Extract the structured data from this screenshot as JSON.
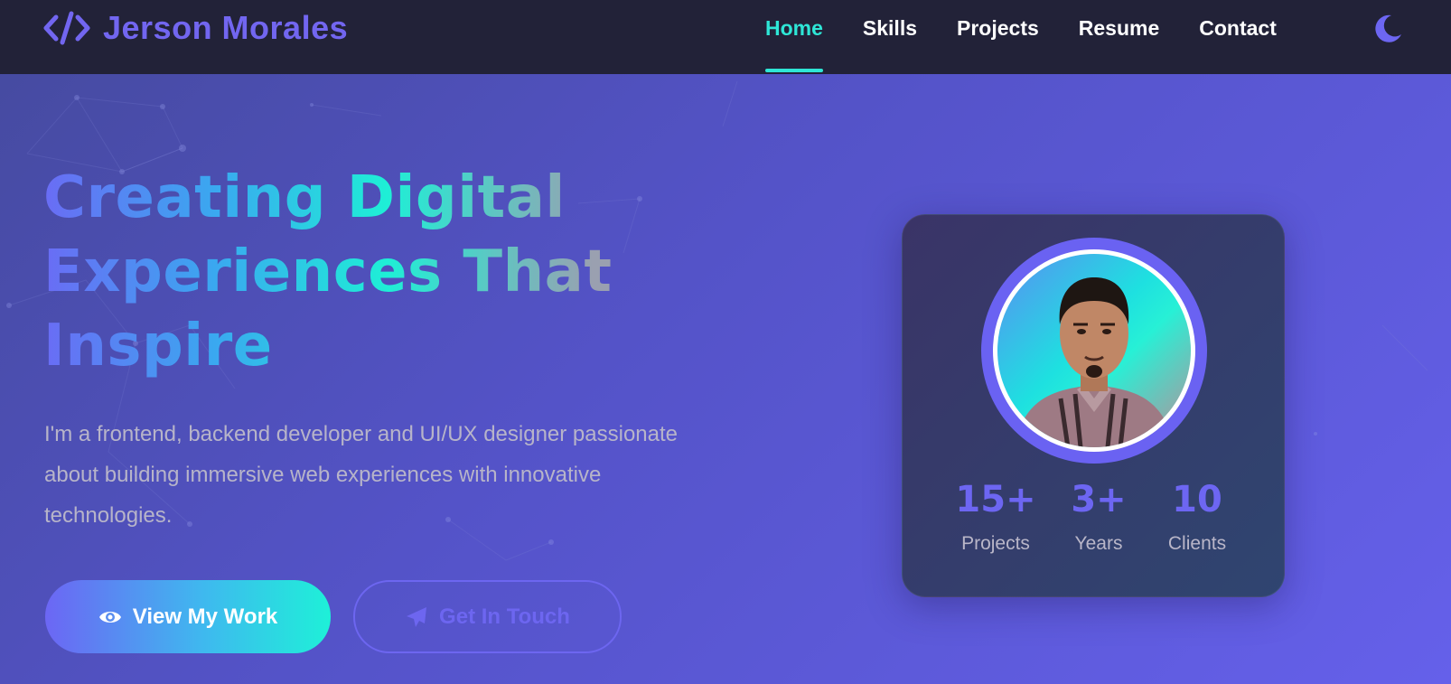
{
  "brand": {
    "name": "Jerson Morales",
    "logo_icon": "code-icon"
  },
  "nav": {
    "items": [
      {
        "label": "Home",
        "active": true
      },
      {
        "label": "Skills",
        "active": false
      },
      {
        "label": "Projects",
        "active": false
      },
      {
        "label": "Resume",
        "active": false
      },
      {
        "label": "Contact",
        "active": false
      }
    ],
    "theme_toggle_icon": "moon-icon"
  },
  "hero": {
    "title_lines": [
      "Creating Digital",
      "Experiences That",
      "Inspire"
    ],
    "description": "I'm a frontend, backend developer and UI/UX designer passionate about building immersive web experiences with innovative technologies.",
    "primary_button": {
      "label": "View My Work",
      "icon": "eye-icon"
    },
    "secondary_button": {
      "label": "Get In Touch",
      "icon": "paper-plane-icon"
    }
  },
  "profile_card": {
    "stats": [
      {
        "value": "15+",
        "label": "Projects"
      },
      {
        "value": "3+",
        "label": "Years"
      },
      {
        "value": "10",
        "label": "Clients"
      }
    ]
  },
  "colors": {
    "accent": "#6d66f2",
    "active_nav": "#2ee6d6",
    "navbar_bg": "#222238"
  }
}
